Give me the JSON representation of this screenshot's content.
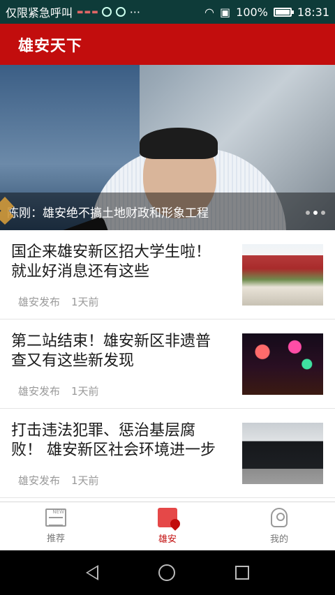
{
  "status_bar": {
    "left_text": "仅限紧急呼叫",
    "battery": "100%",
    "time": "18:31",
    "battery_level": 1.0,
    "icons": [
      "signal-icon",
      "notification-icon",
      "wifi-icon",
      "sim-icon",
      "battery-icon"
    ]
  },
  "app_bar": {
    "title": "雄安天下"
  },
  "banner": {
    "caption": "陈刚：雄安绝不搞土地财政和形象工程",
    "page_count": 3,
    "active_index": 0
  },
  "news": [
    {
      "title": "国企来雄安新区招大学生啦！就业好消息还有这些",
      "source": "雄安发布",
      "time": "1天前"
    },
    {
      "title": "第二站结束！雄安新区非遗普查又有这些新发现",
      "source": "雄安发布",
      "time": "1天前"
    },
    {
      "title": "打击违法犯罪、惩治基层腐败！ 雄安新区社会环境进一步",
      "source": "雄安发布",
      "time": "1天前"
    }
  ],
  "tabs": [
    {
      "label": "推荐",
      "icon": "news-icon",
      "active": false
    },
    {
      "label": "雄安",
      "icon": "building-location-icon",
      "active": true
    },
    {
      "label": "我的",
      "icon": "person-icon",
      "active": false
    }
  ],
  "colors": {
    "accent": "#c20d0d",
    "status_bar": "#0e3b39"
  }
}
